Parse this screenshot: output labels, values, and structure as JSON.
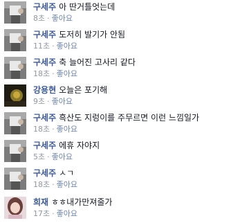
{
  "comments": [
    {
      "author": "구세주",
      "text": "아 딴거틀엇는데",
      "time": "8초",
      "like": "좋아요",
      "avatar": "photo-avatar-icon"
    },
    {
      "author": "구세주",
      "text": "도저히 발기가 안됨",
      "time": "11초",
      "like": "좋아요",
      "avatar": "photo-avatar-icon"
    },
    {
      "author": "구세주",
      "text": "축 늘어진 고사리 같다",
      "time": "18초",
      "like": "좋아요",
      "avatar": "photo-avatar-icon"
    },
    {
      "author": "강용현",
      "text": "오늘은 포기해",
      "time": "9초",
      "like": "좋아요",
      "avatar": "dark-avatar-icon"
    },
    {
      "author": "구세주",
      "text": "흑산도 지렁이를 주무르면 이런 느낌일가",
      "time": "18초",
      "like": "좋아요",
      "avatar": "photo-avatar-icon"
    },
    {
      "author": "구세주",
      "text": "에휴 자야지",
      "time": "5초",
      "like": "좋아요",
      "avatar": "photo-avatar-icon"
    },
    {
      "author": "구세주",
      "text": "ㅅㄱ",
      "time": "18초",
      "like": "좋아요",
      "avatar": "photo-avatar-icon"
    },
    {
      "author": "희재",
      "text": "ㅎㅎ내가만져줄가",
      "time": "17초",
      "like": "좋아요",
      "avatar": "portrait-avatar-icon"
    }
  ],
  "colors": {
    "author": "#3b5998",
    "like_link": "#6d84b4",
    "meta": "#9197a3",
    "text": "#141823"
  }
}
